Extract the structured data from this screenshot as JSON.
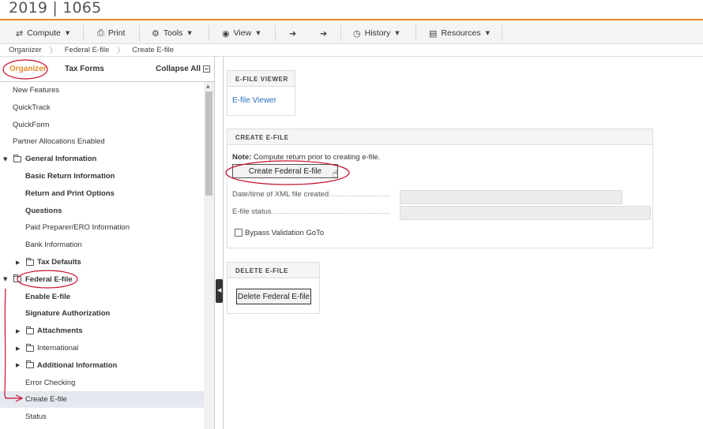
{
  "app": {
    "title": "2019 | 1065"
  },
  "toolbar": {
    "compute": "Compute",
    "print": "Print",
    "tools": "Tools",
    "view": "View",
    "history": "History",
    "resources": "Resources"
  },
  "breadcrumb": [
    "Organizer",
    "Federal E-file",
    "Create E-file"
  ],
  "sidebar": {
    "tabs": [
      "Organizer",
      "Tax Forms"
    ],
    "collapse_label": "Collapse All",
    "items": [
      {
        "label": "New Features"
      },
      {
        "label": "QuickTrack"
      },
      {
        "label": "QuickForm"
      },
      {
        "label": "Partner Allocations Enabled"
      },
      {
        "label": "General Information"
      },
      {
        "label": "Basic Return Information"
      },
      {
        "label": "Return and Print Options"
      },
      {
        "label": "Questions"
      },
      {
        "label": "Paid Preparer/ERO Information"
      },
      {
        "label": "Bank Information"
      },
      {
        "label": "Tax Defaults"
      },
      {
        "label": "Federal E-file"
      },
      {
        "label": "Enable E-file"
      },
      {
        "label": "Signature Authorization"
      },
      {
        "label": "Attachments"
      },
      {
        "label": "International"
      },
      {
        "label": "Additional Information"
      },
      {
        "label": "Error Checking"
      },
      {
        "label": "Create E-file"
      },
      {
        "label": "Status"
      }
    ]
  },
  "efile_viewer": {
    "header": "E-FILE VIEWER",
    "link": "E-file Viewer"
  },
  "create_efile": {
    "header": "CREATE E-FILE",
    "note_label": "Note:",
    "note_text": "Compute return prior to creating e-file.",
    "create_button": "Create Federal E-file",
    "datetime_label": "Date/time of XML file created",
    "status_label": "E-file status",
    "bypass_label": "Bypass Validation GoTo"
  },
  "delete_efile": {
    "header": "DELETE E-FILE",
    "delete_button": "Delete Federal E-file"
  }
}
